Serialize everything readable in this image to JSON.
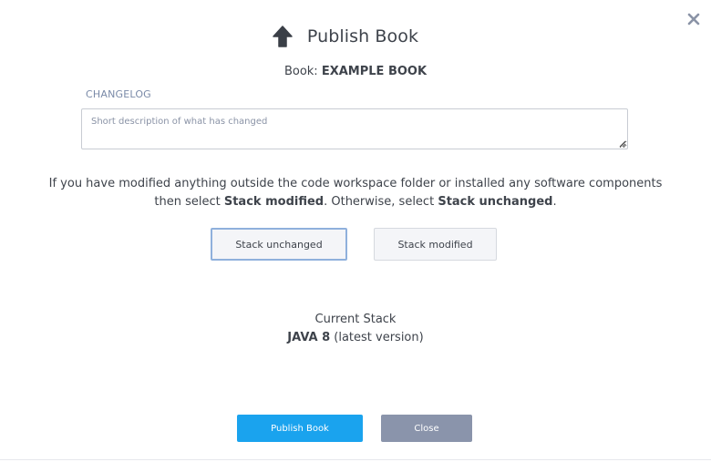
{
  "dialog": {
    "title": "Publish Book",
    "title_icon": "arrow-up-icon",
    "close_icon": "close-icon"
  },
  "book": {
    "prefix": "Book:",
    "name": "EXAMPLE BOOK"
  },
  "changelog": {
    "label": "CHANGELOG",
    "placeholder": "Short description of what has changed",
    "value": ""
  },
  "info": {
    "part1": "If you have modified anything outside the code workspace folder or installed any software components",
    "part2": "then select",
    "strong1": "Stack modified",
    "part3": ". Otherwise, select",
    "strong2": "Stack unchanged",
    "part4": "."
  },
  "stack_options": {
    "unchanged_label": "Stack unchanged",
    "modified_label": "Stack modified",
    "selected": "Stack unchanged"
  },
  "current_stack": {
    "heading": "Current Stack",
    "name": "JAVA 8",
    "version_note": "(latest version)"
  },
  "actions": {
    "publish_label": "Publish Book",
    "close_label": "Close"
  },
  "colors": {
    "primary": "#1aa3ee",
    "secondary": "#8a94ab",
    "selected_border": "#8fb0dc"
  }
}
